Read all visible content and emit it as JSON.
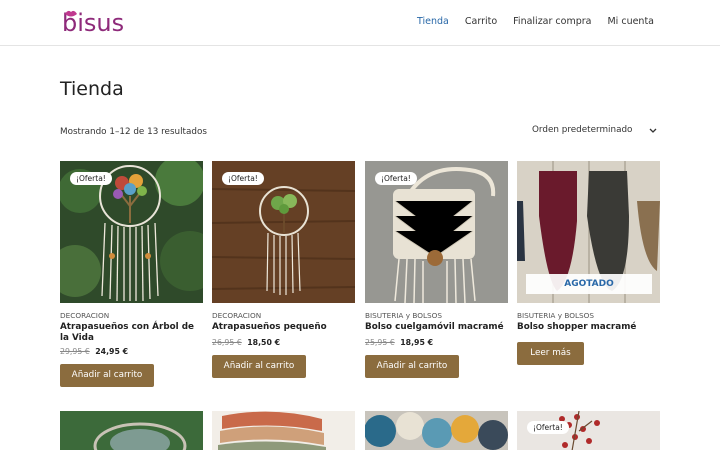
{
  "header": {
    "logo": "bisus",
    "nav": [
      {
        "label": "Tienda",
        "active": true
      },
      {
        "label": "Carrito",
        "active": false
      },
      {
        "label": "Finalizar compra",
        "active": false
      },
      {
        "label": "Mi cuenta",
        "active": false
      }
    ]
  },
  "page": {
    "title": "Tienda",
    "result_count": "Mostrando 1–12 de 13 resultados",
    "orderby": "Orden predeterminado"
  },
  "products": [
    {
      "category": "DECORACION",
      "title": "Atrapasueños con Árbol de la Vida",
      "badge": "¡Oferta!",
      "price_old": "29,95 €",
      "price_new": "24,95 €",
      "button": "Añadir al carrito"
    },
    {
      "category": "DECORACION",
      "title": "Atrapasueños pequeño",
      "badge": "¡Oferta!",
      "price_old": "26,95 €",
      "price_new": "18,50 €",
      "button": "Añadir al carrito"
    },
    {
      "category": "BISUTERIA y BOLSOS",
      "title": "Bolso cuelgamóvil macramé",
      "badge": "¡Oferta!",
      "price_old": "25,95 €",
      "price_new": "18,95 €",
      "button": "Añadir al carrito"
    },
    {
      "category": "BISUTERIA y BOLSOS",
      "title": "Bolso shopper macramé",
      "soldout": "AGOTADO",
      "button": "Leer más"
    }
  ],
  "row2_badge": "¡Oferta!",
  "colors": {
    "accent": "#2968a8",
    "button": "#8b6c3e",
    "brand": "#8e2a7a"
  }
}
